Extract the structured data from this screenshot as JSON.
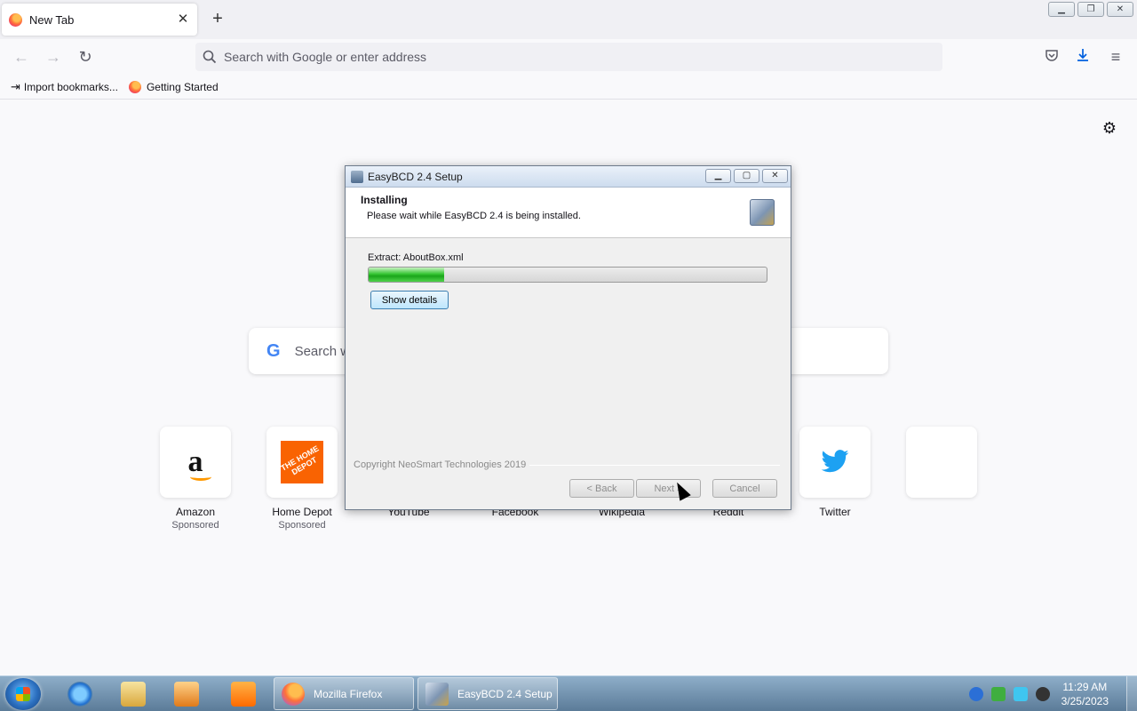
{
  "browser": {
    "tab_title": "New Tab",
    "url_placeholder": "Search with Google or enter address",
    "bookmarks": [
      "Import bookmarks...",
      "Getting Started"
    ]
  },
  "newtab": {
    "search_placeholder": "Search w",
    "shortcuts": [
      {
        "name": "Amazon",
        "sub": "Sponsored"
      },
      {
        "name": "Home Depot",
        "sub": "Sponsored"
      },
      {
        "name": "YouTube",
        "sub": ""
      },
      {
        "name": "Facebook",
        "sub": ""
      },
      {
        "name": "Wikipedia",
        "sub": ""
      },
      {
        "name": "Reddit",
        "sub": ""
      },
      {
        "name": "Twitter",
        "sub": ""
      }
    ],
    "amazon_logo": "a",
    "homedepot_logo": "THE HOME DEPOT"
  },
  "dialog": {
    "title": "EasyBCD 2.4 Setup",
    "heading": "Installing",
    "subheading": "Please wait while EasyBCD 2.4 is being installed.",
    "status": "Extract: AboutBox.xml",
    "progress_fraction": 0.19,
    "show_details": "Show details",
    "copyright": "Copyright NeoSmart Technologies 2019",
    "back": "< Back",
    "next": "Next >",
    "cancel": "Cancel"
  },
  "taskbar": {
    "tasks": [
      "Mozilla Firefox",
      "EasyBCD 2.4 Setup"
    ],
    "time": "11:29 AM",
    "date": "3/25/2023"
  },
  "colors": {
    "firefox_accent": "#ff7139",
    "progress_green": "#37c634",
    "twitter_blue": "#1da1f2",
    "homedepot_orange": "#f96302"
  }
}
